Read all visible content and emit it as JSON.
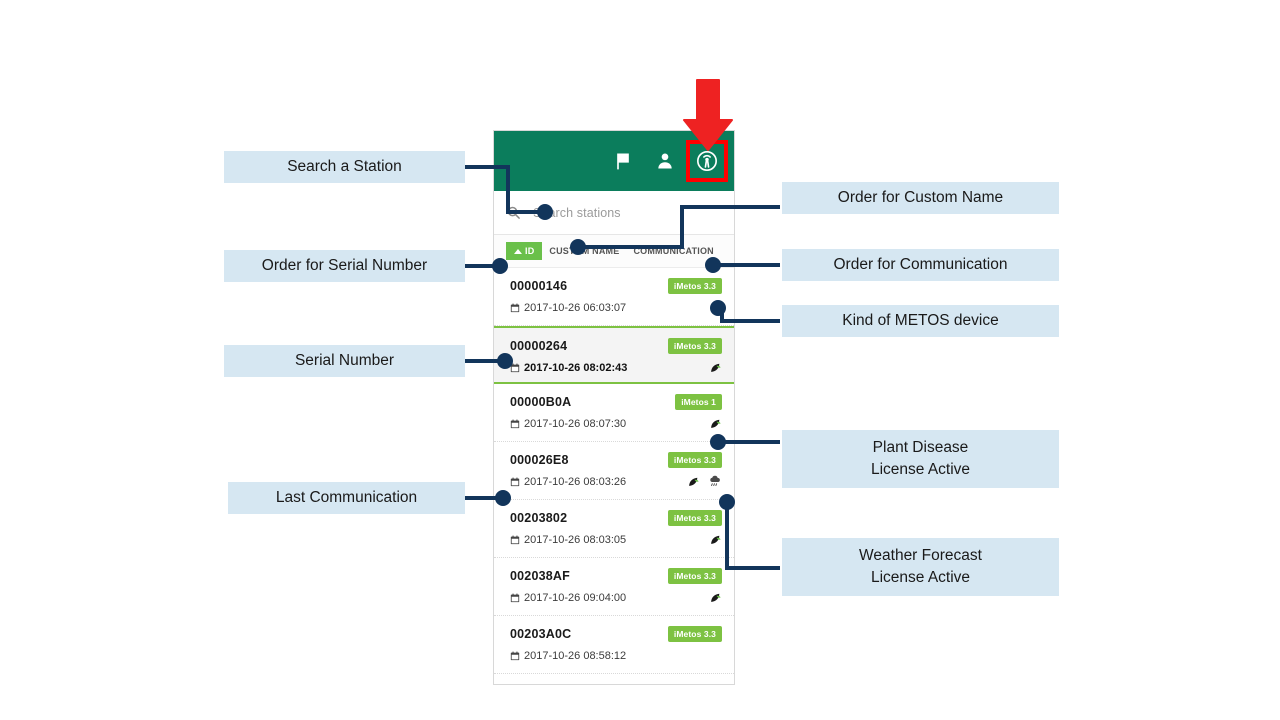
{
  "app": {
    "header": {
      "icons": [
        {
          "name": "flag-icon",
          "label": "flag"
        },
        {
          "name": "person-icon",
          "label": "account"
        },
        {
          "name": "radio-broadcast-icon",
          "label": "stations"
        }
      ]
    },
    "search": {
      "placeholder": "Search stations",
      "value": "",
      "icon": "search-icon"
    },
    "sort_chips": [
      {
        "label": "ID",
        "active": true,
        "direction": "asc"
      },
      {
        "label": "CUSTOM NAME",
        "active": false
      },
      {
        "label": "COMMUNICATION",
        "active": false
      }
    ],
    "stations": [
      {
        "serial": "00000146",
        "timestamp": "2017-10-26 06:03:07",
        "device": "iMetos 3.3",
        "selected": false,
        "plant_disease": false,
        "weather_forecast": false
      },
      {
        "serial": "00000264",
        "timestamp": "2017-10-26 08:02:43",
        "device": "iMetos 3.3",
        "selected": true,
        "plant_disease": true,
        "weather_forecast": false
      },
      {
        "serial": "00000B0A",
        "timestamp": "2017-10-26 08:07:30",
        "device": "iMetos 1",
        "selected": false,
        "plant_disease": true,
        "weather_forecast": false
      },
      {
        "serial": "000026E8",
        "timestamp": "2017-10-26 08:03:26",
        "device": "iMetos 3.3",
        "selected": false,
        "plant_disease": true,
        "weather_forecast": true
      },
      {
        "serial": "00203802",
        "timestamp": "2017-10-26 08:03:05",
        "device": "iMetos 3.3",
        "selected": false,
        "plant_disease": true,
        "weather_forecast": false
      },
      {
        "serial": "002038AF",
        "timestamp": "2017-10-26 09:04:00",
        "device": "iMetos 3.3",
        "selected": false,
        "plant_disease": true,
        "weather_forecast": false
      },
      {
        "serial": "00203A0C",
        "timestamp": "2017-10-26 08:58:12",
        "device": "iMetos 3.3",
        "selected": false,
        "plant_disease": false,
        "weather_forecast": false
      }
    ]
  },
  "annotations": {
    "search_a_station": "Search a Station",
    "order_for_serial_number": "Order for Serial Number",
    "serial_number": "Serial Number",
    "last_communication": "Last Communication",
    "order_for_custom_name": "Order for Custom Name",
    "order_for_communication": "Order for Communication",
    "kind_of_metos_device": "Kind of METOS device",
    "plant_disease_line1": "Plant Disease",
    "plant_disease_line2": "License Active",
    "weather_forecast_line1": "Weather Forecast",
    "weather_forecast_line2": "License Active"
  },
  "colors": {
    "header_green": "#0b7d5c",
    "badge_green": "#7dc242",
    "chip_green": "#6ac04a",
    "annotation_bg": "#d6e7f2",
    "connector_navy": "#12355b",
    "highlight_red": "#ff0000"
  }
}
